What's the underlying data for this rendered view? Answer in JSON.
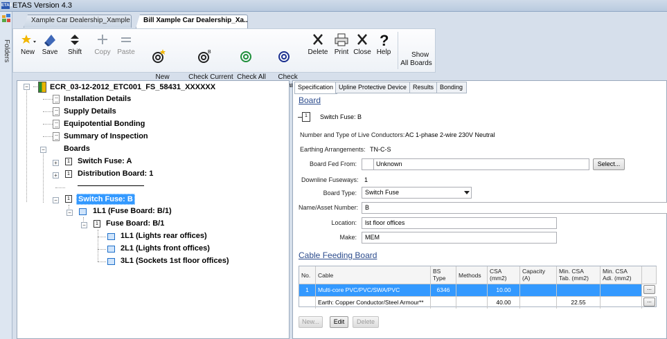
{
  "window": {
    "title": "ETAS Version 4.3",
    "logo_text": "ETAS"
  },
  "sidebar": {
    "label": "Folders"
  },
  "doc_tabs": [
    {
      "label": "Xample Car Dealership_Xample ..."
    },
    {
      "label": "Bill Xample Car Dealership_Xa..."
    }
  ],
  "toolbar": {
    "new": "New",
    "save": "Save",
    "shift": "Shift",
    "copy": "Copy",
    "paste": "Paste",
    "new_observation": "New\nObservation",
    "check_current_board": "Check Current\nBoard",
    "check_all_boards": "Check All\nBoards",
    "check_compliance": "Check\nCompliance",
    "delete": "Delete",
    "print": "Print",
    "close": "Close",
    "help": "Help",
    "show_all_boards": "Show\nAll Boards"
  },
  "tree": {
    "root": "ECR_03-12-2012_ETC001_FS_58431_XXXXXX",
    "items": [
      "Installation Details",
      "Supply Details",
      "Equipotential Bonding",
      "Summary of Inspection"
    ],
    "boards_label": "Boards",
    "switch_fuse_a": "Switch Fuse: A",
    "distribution_board": "Distribution Board: 1",
    "switch_fuse_b": "Switch Fuse: B",
    "fuse_board_way": "1L1 (Fuse Board: B/1)",
    "fuse_board": "Fuse Board: B/1",
    "circuits": [
      "1L1 (Lights rear offices)",
      "2L1 (Lights front offices)",
      "3L1 (Sockets 1st floor offices)"
    ]
  },
  "panel": {
    "tabs": [
      "Specification",
      "Upline Protective Device",
      "Results",
      "Bonding"
    ],
    "board_heading": "Board",
    "board_name": "Switch Fuse: B",
    "conductors_label": "Number and Type of Live Conductors:",
    "conductors_value": "AC 1-phase 2-wire 230V Neutral",
    "earthing_label": "Earthing Arrangements:",
    "earthing_value": "TN-C-S",
    "fed_from_label": "Board Fed From:",
    "fed_from_value": "Unknown",
    "select_button": "Select...",
    "fuseways_label": "Downline Fuseways:",
    "fuseways_value": "1",
    "board_type_label": "Board Type:",
    "board_type_value": "Switch Fuse",
    "name_label": "Name/Asset Number:",
    "name_value": "B",
    "location_label": "Location:",
    "location_value": "lst floor offices",
    "make_label": "Make:",
    "make_value": "MEM",
    "cable_heading": "Cable Feeding Board",
    "cable_columns": [
      "No.",
      "Cable",
      "BS\nType",
      "Methods",
      "CSA\n(mm2)",
      "Capacity\n(A)",
      "Min. CSA\nTab. (mm2)",
      "Min. CSA\nAdi. (mm2)"
    ],
    "cable_rows": [
      {
        "no": "1",
        "cable": "Multi-core PVC/PVC/SWA/PVC",
        "bs_type": "6346",
        "methods": "",
        "csa": "10.00",
        "capacity": "",
        "min_tab": "",
        "min_adi": ""
      },
      {
        "no": "",
        "cable": "Earth: Copper Conductor/Steel Armour**",
        "bs_type": "",
        "methods": "",
        "csa": "40.00",
        "capacity": "",
        "min_tab": "22.55",
        "min_adi": ""
      }
    ],
    "more_button": "...",
    "new_button": "New...",
    "edit_button": "Edit",
    "delete_button": "Delete"
  }
}
